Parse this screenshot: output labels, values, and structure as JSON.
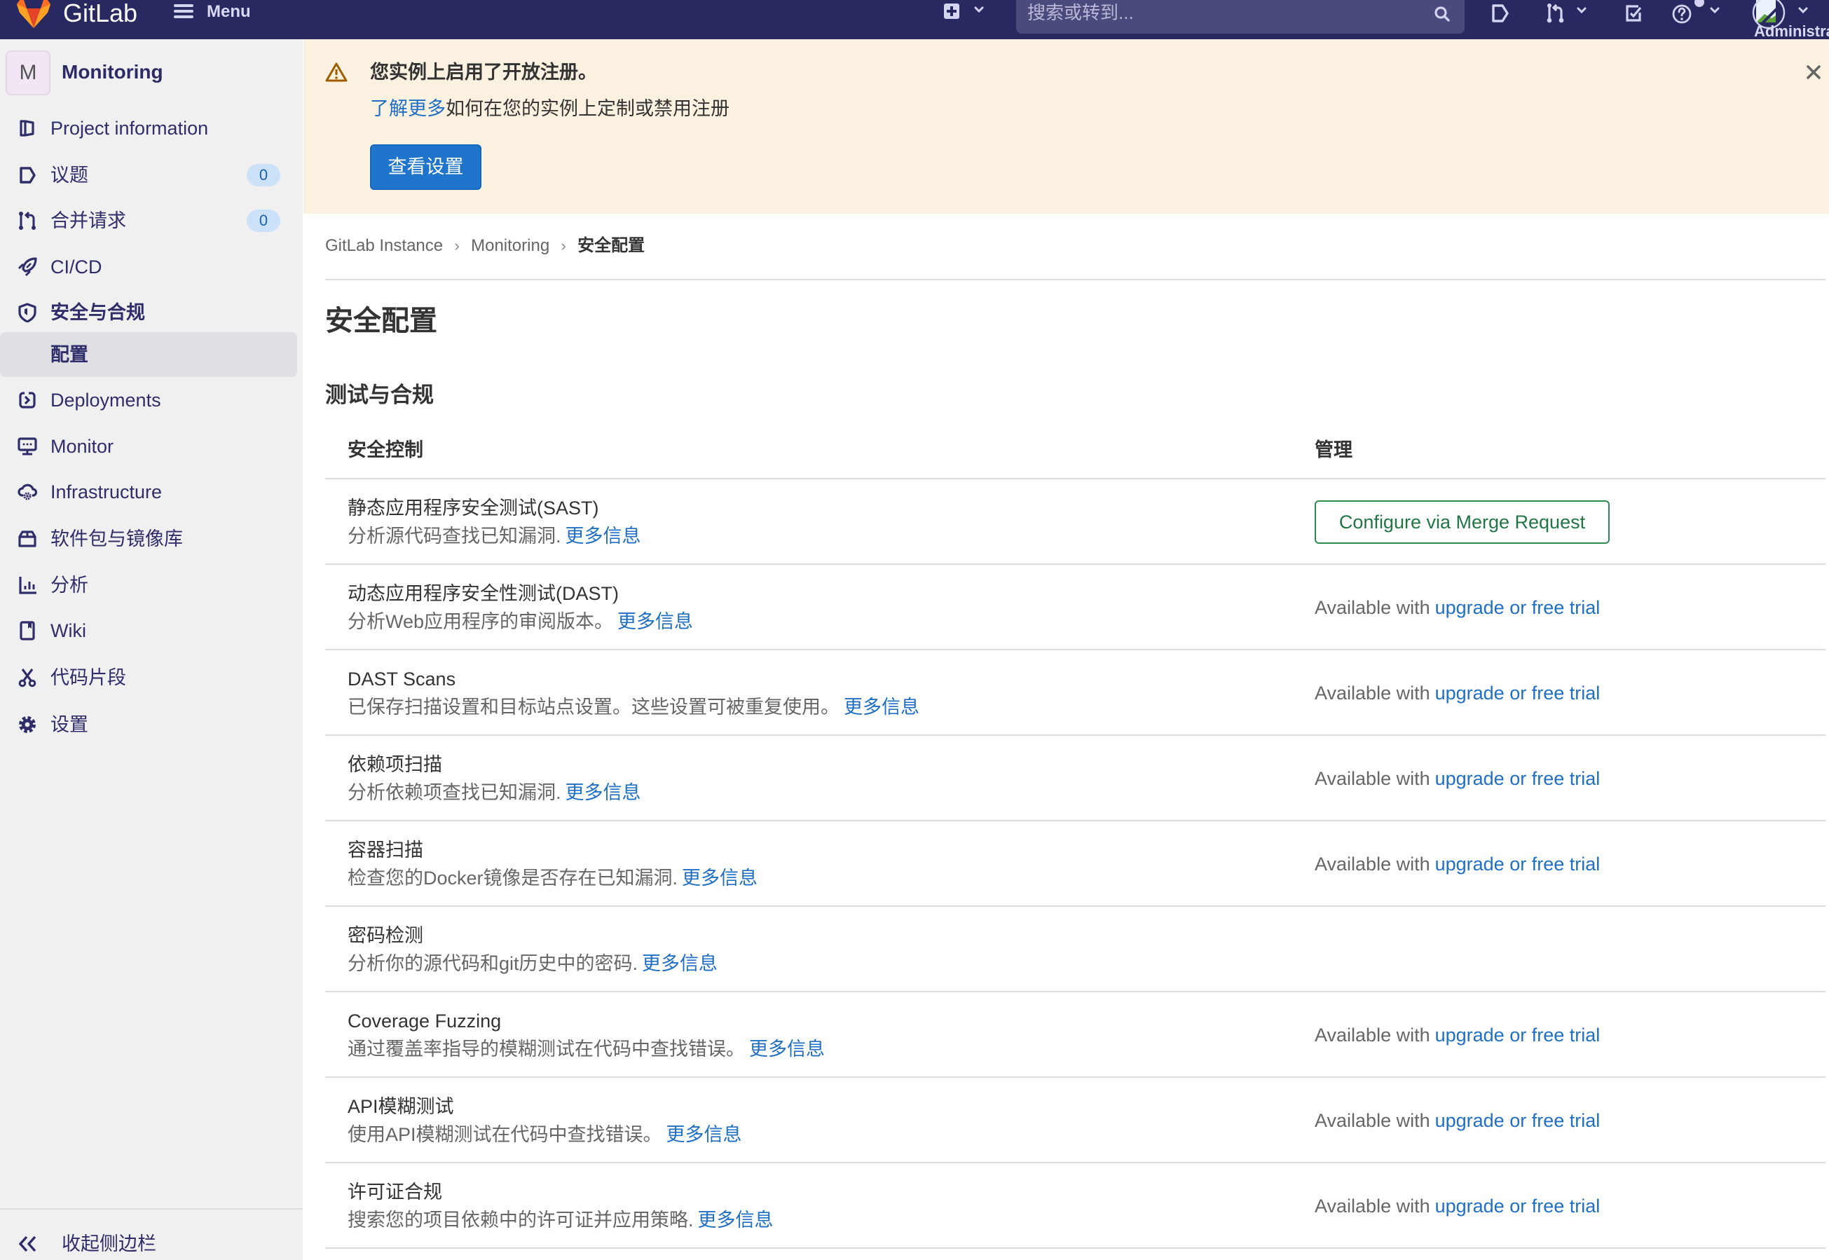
{
  "header": {
    "brand": "GitLab",
    "menu_label": "Menu",
    "search_placeholder": "搜索或转到...",
    "user_name": "Administrator"
  },
  "sidebar": {
    "project": {
      "avatar_letter": "M",
      "name": "Monitoring"
    },
    "items": [
      {
        "label": "Project information",
        "icon": "project-information-icon"
      },
      {
        "label": "议题",
        "icon": "issues-icon",
        "badge": "0"
      },
      {
        "label": "合并请求",
        "icon": "merge-request-icon",
        "badge": "0"
      },
      {
        "label": "CI/CD",
        "icon": "rocket-icon"
      },
      {
        "label": "安全与合规",
        "icon": "shield-icon",
        "expanded": true
      },
      {
        "label": "配置",
        "active": true
      },
      {
        "label": "Deployments",
        "icon": "deployments-icon"
      },
      {
        "label": "Monitor",
        "icon": "monitor-icon"
      },
      {
        "label": "Infrastructure",
        "icon": "cloud-gear-icon"
      },
      {
        "label": "软件包与镜像库",
        "icon": "package-icon"
      },
      {
        "label": "分析",
        "icon": "analytics-icon"
      },
      {
        "label": "Wiki",
        "icon": "book-icon"
      },
      {
        "label": "代码片段",
        "icon": "scissors-icon"
      },
      {
        "label": "设置",
        "icon": "settings-gear-icon"
      }
    ],
    "collapse_label": "收起侧边栏"
  },
  "banner": {
    "title": "您实例上启用了开放注册。",
    "link_text": "了解更多",
    "body_text": "如何在您的实例上定制或禁用注册",
    "button_label": "查看设置"
  },
  "breadcrumb": [
    "GitLab Instance",
    "Monitoring",
    "安全配置"
  ],
  "page_title": "安全配置",
  "section_title": "测试与合规",
  "table": {
    "headers": [
      "安全控制",
      "管理"
    ],
    "rows": [
      {
        "title": "静态应用程序安全测试(SAST)",
        "description": "分析源代码查找已知漏洞.",
        "more_link": "更多信息",
        "manage": {
          "type": "button",
          "label": "Configure via Merge Request"
        }
      },
      {
        "title": "动态应用程序安全性测试(DAST)",
        "description": "分析Web应用程序的审阅版本。",
        "more_link": "更多信息",
        "manage": {
          "type": "upgrade",
          "prefix": "Available with",
          "link": "upgrade or free trial"
        }
      },
      {
        "title": "DAST Scans",
        "description": "已保存扫描设置和目标站点设置。这些设置可被重复使用。",
        "more_link": "更多信息",
        "manage": {
          "type": "upgrade",
          "prefix": "Available with",
          "link": "upgrade or free trial"
        }
      },
      {
        "title": "依赖项扫描",
        "description": "分析依赖项查找已知漏洞.",
        "more_link": "更多信息",
        "manage": {
          "type": "upgrade",
          "prefix": "Available with",
          "link": "upgrade or free trial"
        }
      },
      {
        "title": "容器扫描",
        "description": "检查您的Docker镜像是否存在已知漏洞.",
        "more_link": "更多信息",
        "manage": {
          "type": "upgrade",
          "prefix": "Available with",
          "link": "upgrade or free trial"
        }
      },
      {
        "title": "密码检测",
        "description": "分析你的源代码和git历史中的密码.",
        "more_link": "更多信息",
        "manage": null
      },
      {
        "title": "Coverage Fuzzing",
        "description": "通过覆盖率指导的模糊测试在代码中查找错误。",
        "more_link": "更多信息",
        "manage": {
          "type": "upgrade",
          "prefix": "Available with",
          "link": "upgrade or free trial"
        }
      },
      {
        "title": "API模糊测试",
        "description": "使用API模糊测试在代码中查找错误。",
        "more_link": "更多信息",
        "manage": {
          "type": "upgrade",
          "prefix": "Available with",
          "link": "upgrade or free trial"
        }
      },
      {
        "title": "许可证合规",
        "description": "搜索您的项目依赖中的许可证并应用策略.",
        "more_link": "更多信息",
        "manage": {
          "type": "upgrade",
          "prefix": "Available with",
          "link": "upgrade or free trial"
        }
      }
    ]
  },
  "colors": {
    "topbar": "#292961",
    "sidebar_bg": "#f0f0f0",
    "sidebar_text": "#2f2d6a",
    "sidebar_active": "#dfdfe4",
    "banner_bg": "#fbf1e0",
    "warning": "#a35b00",
    "link": "#1f6fc5",
    "primary_button": "#1f75cb",
    "confirm_outline": "#217645",
    "badge_bg": "#cbe2f9"
  }
}
